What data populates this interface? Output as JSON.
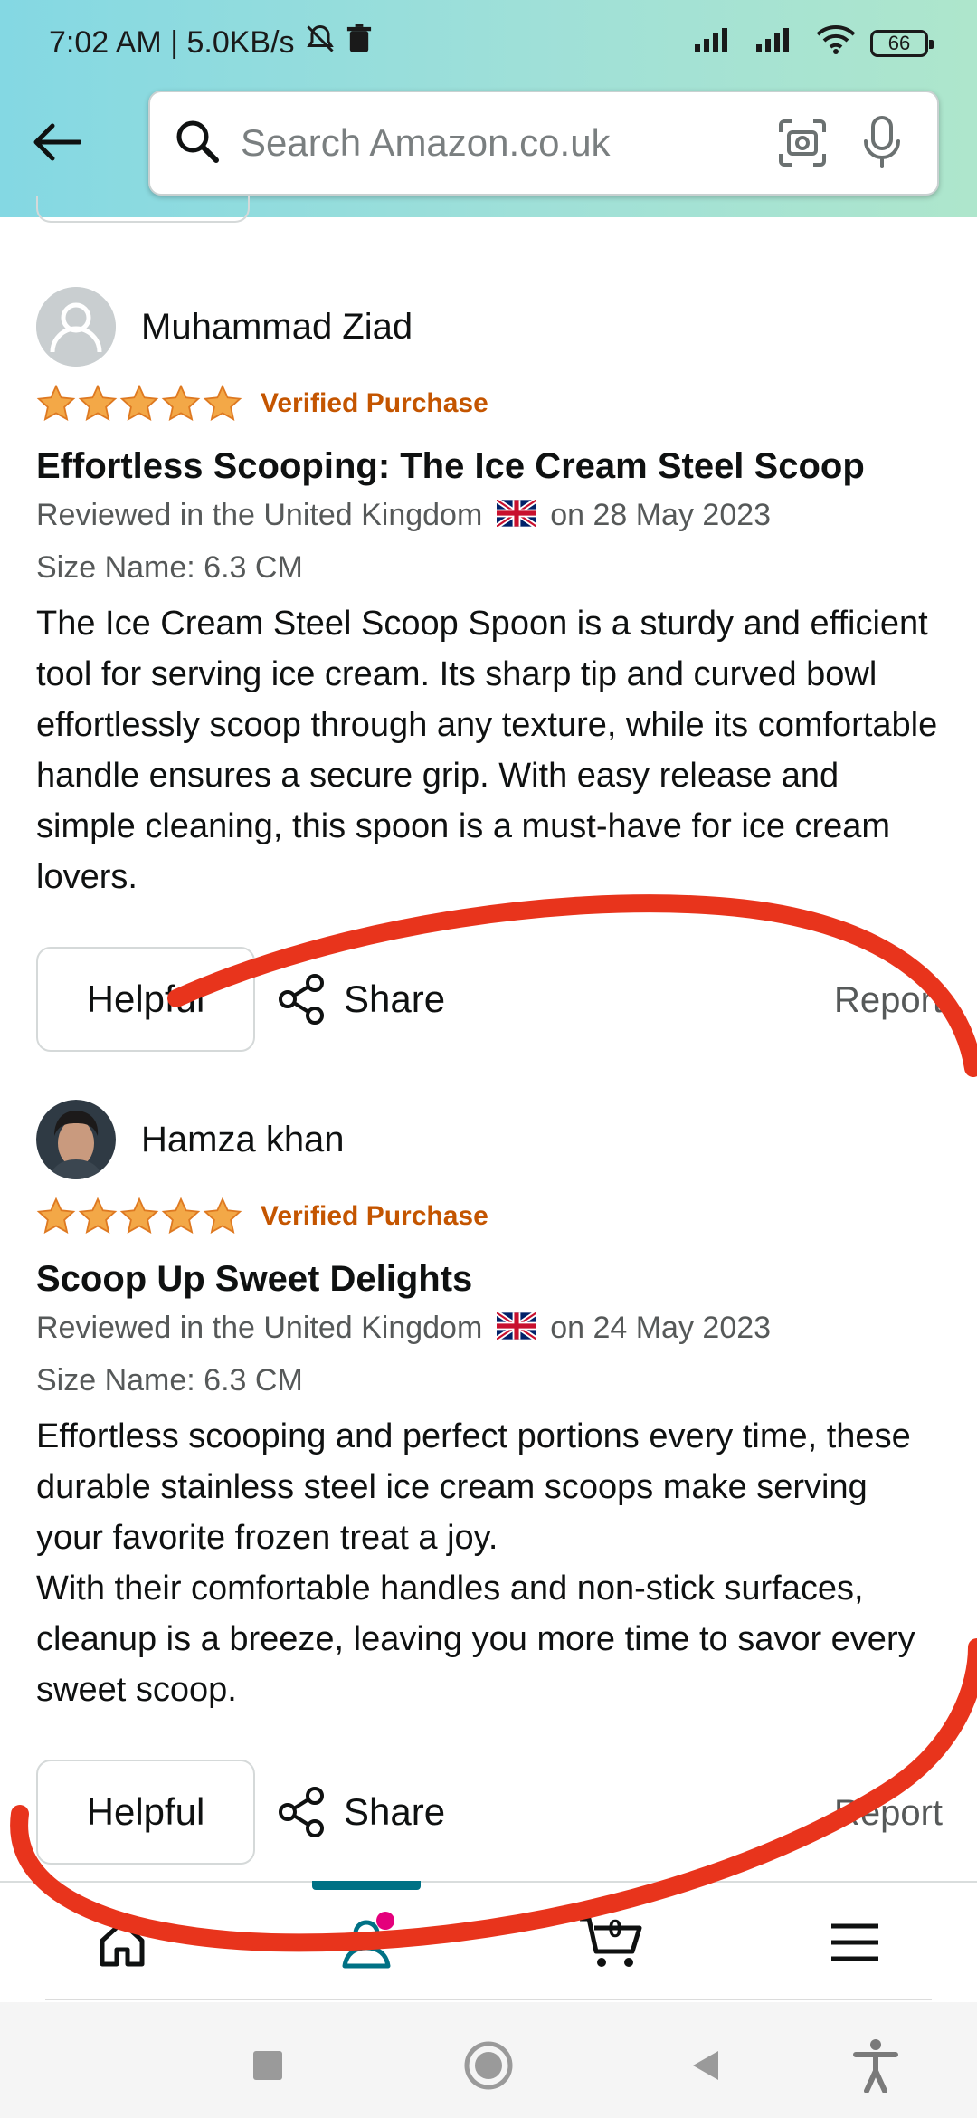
{
  "status_bar": {
    "time_speed": "7:02 AM | 5.0KB/s",
    "battery": "66"
  },
  "search": {
    "placeholder": "Search Amazon.co.uk"
  },
  "reviews": [
    {
      "reviewer": "Muhammad Ziad",
      "rating": 5,
      "verified": "Verified Purchase",
      "title": "Effortless Scooping: The Ice Cream Steel Scoop",
      "reviewed_in": "Reviewed in the United Kingdom",
      "date": "on 28 May 2023",
      "size": "Size Name: 6.3 CM",
      "body": "The Ice Cream Steel Scoop Spoon is a sturdy and efficient tool for serving ice cream. Its sharp tip and curved bowl effortlessly scoop through any texture, while its comfortable handle ensures a secure grip. With easy release and simple cleaning, this spoon is a must-have for ice cream lovers.",
      "helpful": "Helpful",
      "share": "Share",
      "report": "Report"
    },
    {
      "reviewer": "Hamza khan",
      "rating": 5,
      "verified": "Verified Purchase",
      "title": "Scoop Up Sweet Delights",
      "reviewed_in": "Reviewed in the United Kingdom",
      "date": "on 24 May 2023",
      "size": "Size Name: 6.3 CM",
      "body": "Effortless scooping and perfect portions every time, these durable stainless steel ice cream scoops make serving your favorite frozen treat a joy.\nWith their comfortable handles and non-stick surfaces, cleanup is a breeze, leaving you more time to savor every sweet scoop.",
      "helpful": "Helpful",
      "share": "Share",
      "report": "Report"
    }
  ],
  "bottom_nav": {
    "cart_count": "0",
    "active": "account"
  },
  "colors": {
    "verified": "#c45500",
    "star": "#f3a847",
    "accent": "#007185",
    "annotation": "#e8341c"
  }
}
